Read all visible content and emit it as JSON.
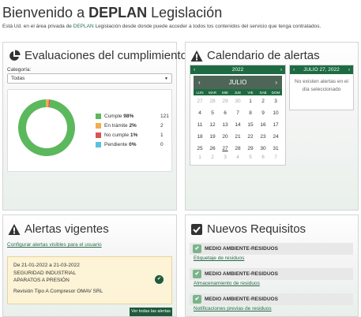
{
  "header": {
    "title_prefix": "Bienvenido a",
    "title_brand": "DEPLAN",
    "title_suffix": "Legislación"
  },
  "subtitle": {
    "part1": "Está Ud. en el área privada de",
    "brand": "DEPLAN",
    "part2": "Legislación desde donde puede acceder a todos los contenidos del servicio que tenga contratados."
  },
  "eval": {
    "title": "Evaluaciones del cumplimiento",
    "category_label": "Categoría:",
    "category_value": "Todas",
    "legend": [
      {
        "label": "Cumple",
        "pct": "98%",
        "count": "121",
        "color": "#5cb85c"
      },
      {
        "label": "En trámite",
        "pct": "2%",
        "count": "2",
        "color": "#f0ad4e"
      },
      {
        "label": "No cumple",
        "pct": "1%",
        "count": "1",
        "color": "#d9534f"
      },
      {
        "label": "Pendiente",
        "pct": "0%",
        "count": "0",
        "color": "#5bc0de"
      }
    ]
  },
  "chart_data": {
    "type": "pie",
    "categories": [
      "Cumple",
      "En trámite",
      "No cumple",
      "Pendiente"
    ],
    "values": [
      121,
      2,
      1,
      0
    ]
  },
  "calendar": {
    "title": "Calendario de alertas",
    "year": "2022",
    "month": "JULIO",
    "dow": [
      "LUN",
      "MAR",
      "MIE",
      "JUE",
      "VIE",
      "SAB",
      "DOM"
    ],
    "weeks": [
      [
        "27",
        "28",
        "29",
        "30",
        "1",
        "2",
        "3"
      ],
      [
        "4",
        "5",
        "6",
        "7",
        "8",
        "9",
        "10"
      ],
      [
        "11",
        "12",
        "13",
        "14",
        "15",
        "16",
        "17"
      ],
      [
        "18",
        "19",
        "20",
        "21",
        "22",
        "23",
        "24"
      ],
      [
        "25",
        "26",
        "27",
        "28",
        "29",
        "30",
        "31"
      ],
      [
        "1",
        "2",
        "3",
        "4",
        "5",
        "6",
        "7"
      ]
    ],
    "day_header": "JULIO 27, 2022",
    "no_alerts": "No existen alertas en el día seleccionado",
    "prev": "‹",
    "next": "›"
  },
  "alertas": {
    "title": "Alertas vigentes",
    "config_link": "Configurar alertas visibles para el usuario",
    "item": {
      "dates": "De 21-01-2022 a 21-03-2022",
      "line1": "SEGURIDAD INDUSTRIAL",
      "line2": "APARATOS A PRESIÓN",
      "line3": "Revisión Tipo A Compresor OMAV SRL"
    },
    "button": "Ver todas las alertas"
  },
  "requisitos": {
    "title": "Nuevos Requisitos",
    "items": [
      {
        "head": "MEDIO AMBIENTE-RESIDUOS",
        "link": "Etiquetaje de residuos"
      },
      {
        "head": "MEDIO AMBIENTE-RESIDUOS",
        "link": "Almacenamiento de residuos"
      },
      {
        "head": "MEDIO AMBIENTE-RESIDUOS",
        "link": "Notificaciones previas de residuos"
      }
    ]
  }
}
